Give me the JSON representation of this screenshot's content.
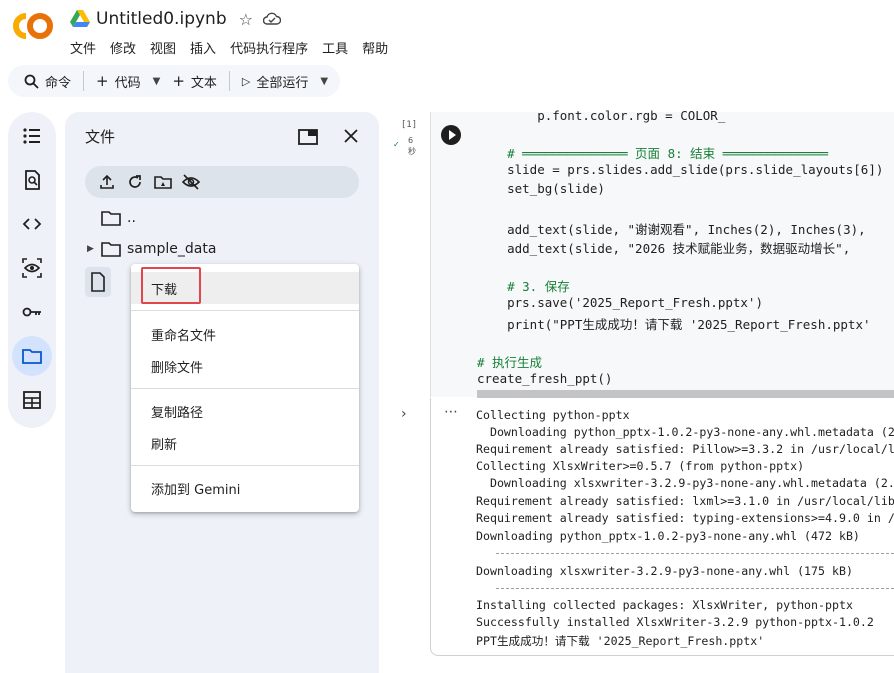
{
  "header": {
    "doc_title": "Untitled0.ipynb",
    "logo_text": "CO",
    "menu": [
      "文件",
      "修改",
      "视图",
      "插入",
      "代码执行程序",
      "工具",
      "帮助"
    ]
  },
  "toolbar": {
    "command_label": "命令",
    "code_label": "代码",
    "text_label": "文本",
    "run_all_label": "全部运行"
  },
  "file_panel": {
    "title": "文件",
    "tree": [
      {
        "name": ".."
      },
      {
        "name": "sample_data"
      }
    ]
  },
  "context_menu": {
    "items": [
      "下载",
      "重命名文件",
      "删除文件",
      "复制路径",
      "刷新",
      "添加到 Gemini"
    ]
  },
  "cell": {
    "exec_count": "[1]",
    "time_value": "6",
    "time_unit": "秒",
    "code_lines": [
      "        p.font.color.rgb = COLOR_",
      "    # ══════════════ 页面 8: 结束 ══════════════",
      "    slide = prs.slides.add_slide(prs.slide_layouts[6])",
      "    set_bg(slide)",
      "",
      "    add_text(slide, \"谢谢观看\", Inches(2), Inches(3),",
      "    add_text(slide, \"2026 技术赋能业务，数据驱动增长\",",
      "",
      "    # 3. 保存",
      "    prs.save('2025_Report_Fresh.pptx')",
      "    print(\"PPT生成成功！请下载 '2025_Report_Fresh.pptx'",
      "",
      "# 执行生成",
      "create_fresh_ppt()"
    ]
  },
  "output": {
    "lines": [
      "Collecting python-pptx",
      "  Downloading python_pptx-1.0.2-py3-none-any.whl.metadata (2",
      "Requirement already satisfied: Pillow>=3.3.2 in /usr/local/l",
      "Collecting XlsxWriter>=0.5.7 (from python-pptx)",
      "  Downloading xlsxwriter-3.2.9-py3-none-any.whl.metadata (2.",
      "Requirement already satisfied: lxml>=3.1.0 in /usr/local/lib",
      "Requirement already satisfied: typing-extensions>=4.9.0 in /",
      "Downloading python_pptx-1.0.2-py3-none-any.whl (472 kB)",
      "Downloading xlsxwriter-3.2.9-py3-none-any.whl (175 kB)",
      "Installing collected packages: XlsxWriter, python-pptx",
      "Successfully installed XlsxWriter-3.2.9 python-pptx-1.0.2",
      "PPT生成成功！请下载 '2025_Report_Fresh.pptx'"
    ]
  }
}
